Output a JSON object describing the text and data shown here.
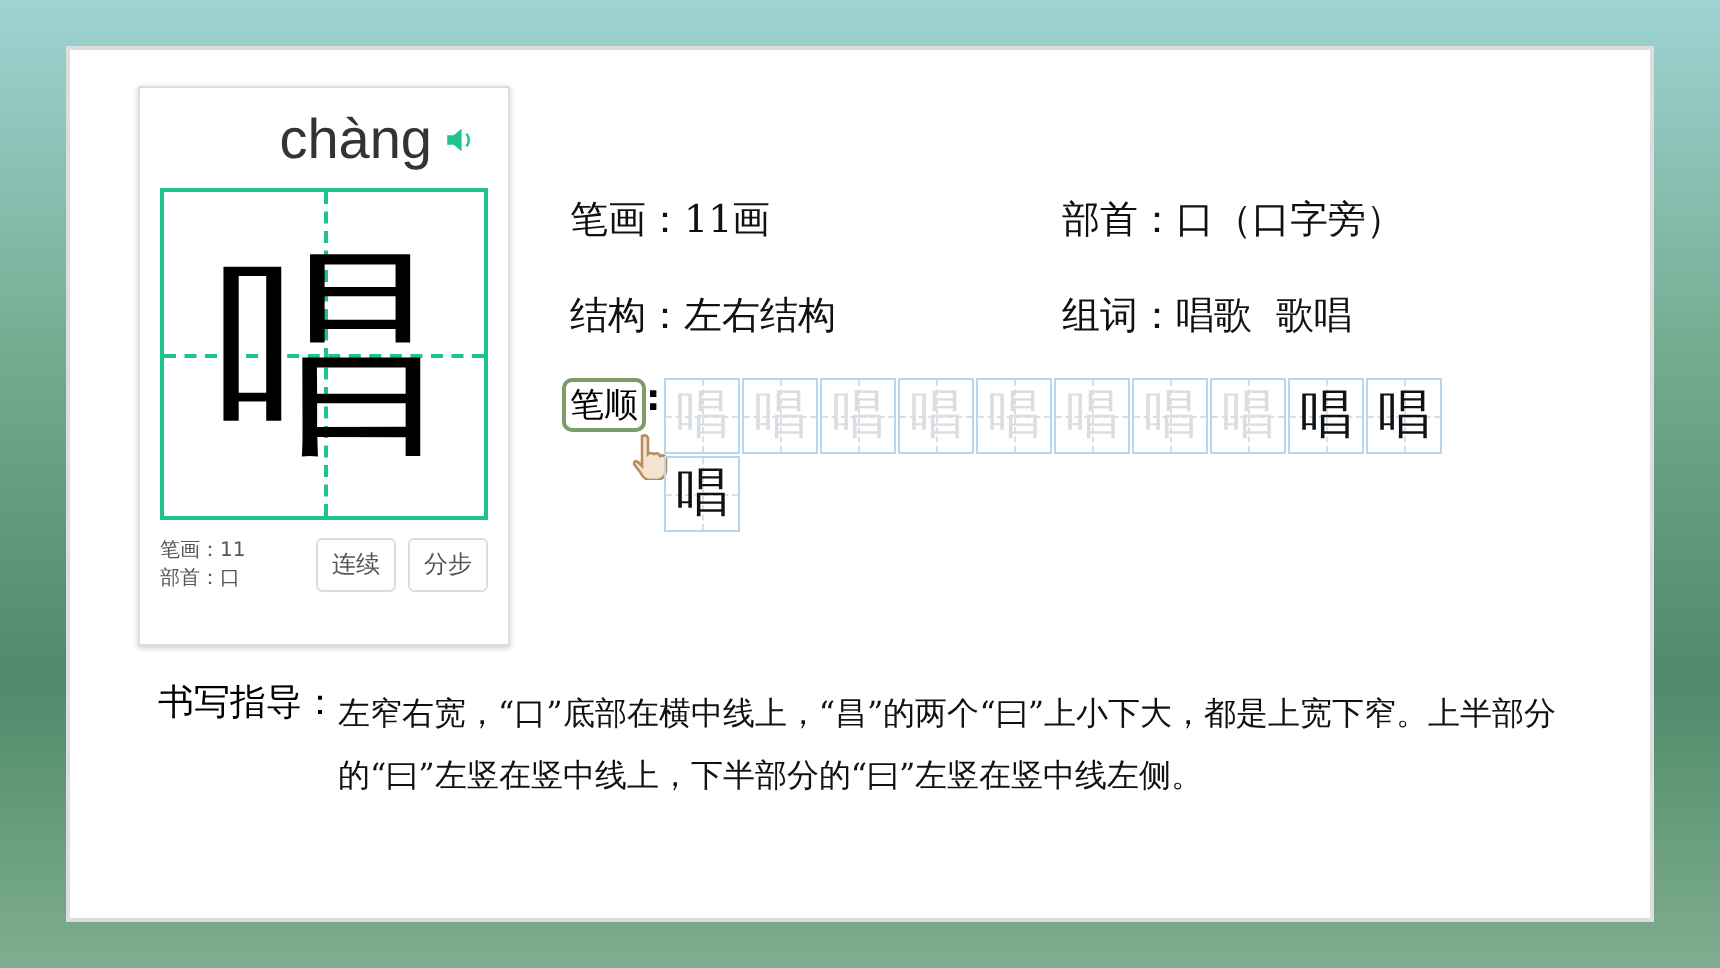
{
  "card": {
    "pinyin": "chàng",
    "character": "唱",
    "strokes_label": "笔画：11",
    "radical_label": "部首：口",
    "buttons": [
      {
        "label": "连续"
      },
      {
        "label": "分步"
      }
    ]
  },
  "info": [
    {
      "label": "笔画：",
      "value": "11画"
    },
    {
      "label": "部首：",
      "value": "口（口字旁）"
    },
    {
      "label": "结构：",
      "value": "左右结构"
    },
    {
      "label": "组词：",
      "value": "唱歌  歌唱"
    }
  ],
  "stroke_order": {
    "label": "笔顺",
    "colon": ":",
    "steps": [
      {
        "char": "唱",
        "complete": false
      },
      {
        "char": "唱",
        "complete": false
      },
      {
        "char": "唱",
        "complete": false
      },
      {
        "char": "唱",
        "complete": false
      },
      {
        "char": "唱",
        "complete": false
      },
      {
        "char": "唱",
        "complete": false
      },
      {
        "char": "唱",
        "complete": false
      },
      {
        "char": "唱",
        "complete": false
      },
      {
        "char": "唱",
        "complete": true
      },
      {
        "char": "唱",
        "complete": true
      },
      {
        "char": "唱",
        "complete": true
      }
    ]
  },
  "guide": {
    "heading": "书写指导：",
    "text": "左窄右宽，“口”底部在横中线上，“昌”的两个“曰”上小下大，都是上宽下窄。上半部分的“曰”左竖在竖中线上，下半部分的“曰”左竖在竖中线左侧。"
  }
}
